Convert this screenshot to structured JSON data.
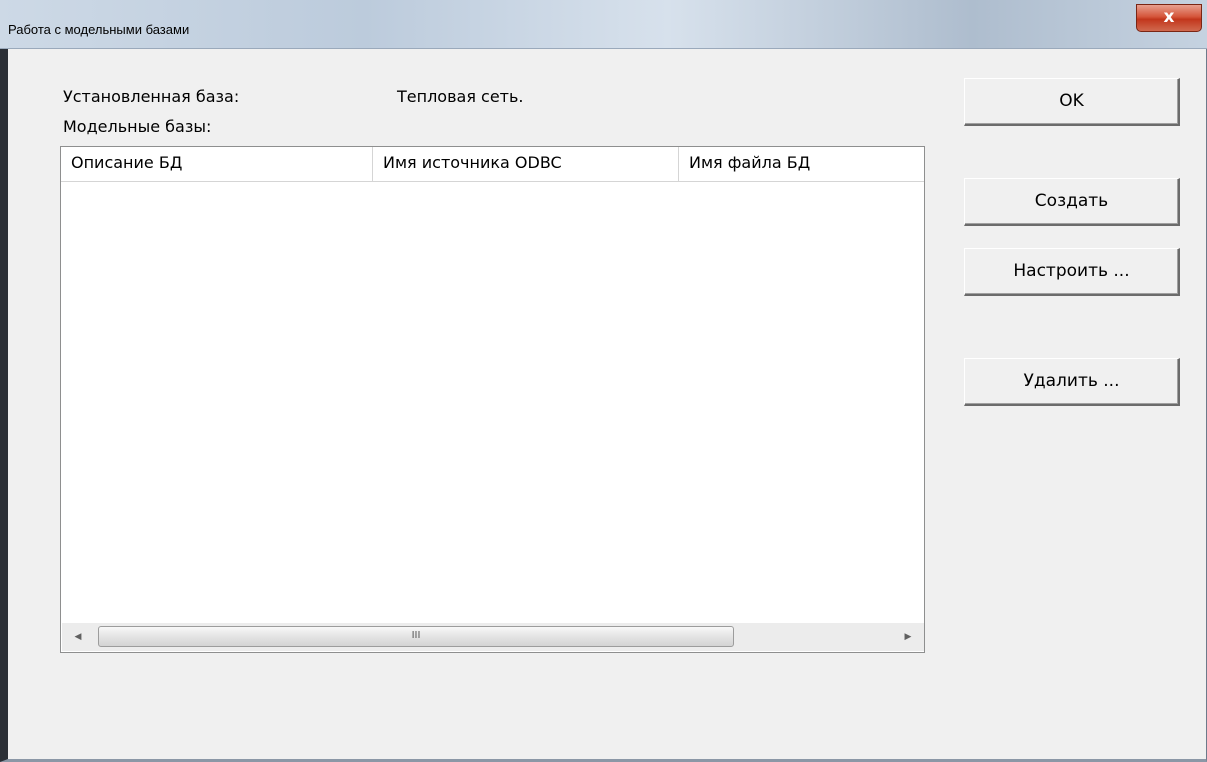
{
  "window": {
    "title": "Работа с модельными базами",
    "close_glyph": "x"
  },
  "installed_base": {
    "label": "Установленная база:",
    "value": "Тепловая сеть."
  },
  "model_bases_label": "Модельные базы:",
  "table": {
    "columns": [
      "Описание БД",
      "Имя источника ODBC",
      "Имя файла БД"
    ],
    "rows": []
  },
  "scrollbar": {
    "left_arrow": "◀",
    "right_arrow": "▶",
    "thumb_grip": "III"
  },
  "buttons": {
    "ok": "OK",
    "create": "Создать",
    "configure": "Настроить ...",
    "delete": "Удалить ..."
  },
  "colors": {
    "dialog_bg": "#f0f0f0",
    "close_button": "#c2361c"
  }
}
